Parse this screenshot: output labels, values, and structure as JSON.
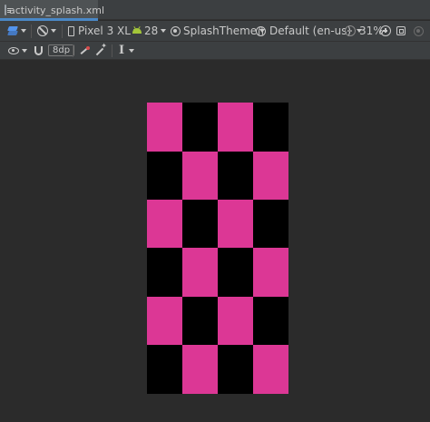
{
  "tab": {
    "title": "activity_splash.xml"
  },
  "toolbar": {
    "device": "Pixel 3 XL",
    "api_level": "28",
    "theme": "SplashTheme",
    "locale": "Default (en-us)",
    "zoom": "31%",
    "margin": "8dp"
  },
  "icons": {
    "file": "xml-file-icon",
    "layers": "design-surface-icon",
    "orientation": "no-rotate-icon",
    "device": "phone-icon",
    "api": "android-icon",
    "theme": "theme-icon",
    "locale": "globe-icon",
    "zoom_out": "zoom-out-icon",
    "zoom_in": "zoom-in-icon",
    "zoom_fit": "zoom-fit-icon",
    "refresh": "refresh-icon",
    "view_options": "eye-icon",
    "autoconnect": "magnet-icon",
    "clear_constraints": "clear-constraints-icon",
    "infer_constraints": "magic-wand-icon",
    "guidelines": "text-cursor-icon"
  },
  "colors": {
    "pink": "#dc3795",
    "black": "#000000",
    "accent": "#4a88c7"
  },
  "preview": {
    "rows": 6,
    "cols": 4,
    "pattern": [
      [
        "pink",
        "black",
        "pink",
        "black"
      ],
      [
        "black",
        "pink",
        "black",
        "pink"
      ],
      [
        "pink",
        "black",
        "pink",
        "black"
      ],
      [
        "black",
        "pink",
        "black",
        "pink"
      ],
      [
        "pink",
        "black",
        "pink",
        "black"
      ],
      [
        "black",
        "pink",
        "black",
        "pink"
      ]
    ]
  }
}
